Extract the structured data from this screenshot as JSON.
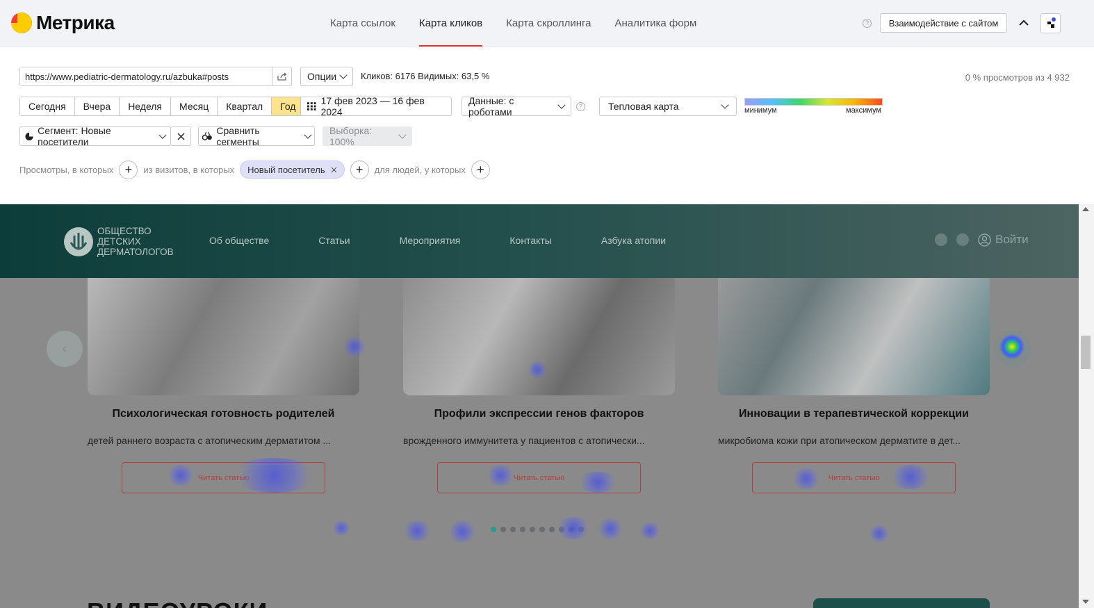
{
  "app": {
    "logo_text": "Метрика"
  },
  "tabs": [
    {
      "label": "Карта ссылок"
    },
    {
      "label": "Карта кликов",
      "active": true
    },
    {
      "label": "Карта скроллинга"
    },
    {
      "label": "Аналитика форм"
    }
  ],
  "header": {
    "help": "?",
    "interact_label": "Взаимодействие с сайтом"
  },
  "controls": {
    "url": "https://www.pediatric-dermatology.ru/azbuka#posts",
    "options_label": "Опции",
    "stats": "Кликов: 6176  Видимых: 63,5 %",
    "views": "0 % просмотров из 4 932",
    "periods": [
      "Сегодня",
      "Вчера",
      "Неделя",
      "Месяц",
      "Квартал",
      "Год"
    ],
    "active_period": "Год",
    "date_range": "17 фев 2023 — 16 фев 2024",
    "data_label": "Данные: с роботами",
    "map_type": "Тепловая карта",
    "legend_min": "минимум",
    "legend_max": "максимум",
    "segment_label": "Сегмент: Новые посетители",
    "compare_label": "Сравнить сегменты",
    "sample_label": "Выборка: 100%"
  },
  "filters": {
    "views_text": "Просмотры, в которых",
    "visits_text": "из визитов, в которых",
    "chip": "Новый посетитель",
    "people_text": "для людей, у которых"
  },
  "site": {
    "logo_text": "Общество детских дерматологов",
    "nav": [
      "Об обществе",
      "Статьи",
      "Мероприятия",
      "Контакты",
      "Азбука атопии"
    ],
    "login": "Войти",
    "cards": [
      {
        "title": "Психологическая готовность родителей",
        "desc": "детей раннего возраста с атопическим дерматитом ...",
        "button": "Читать статью"
      },
      {
        "title": "Профили экспрессии генов факторов",
        "desc": "врожденного иммунитета у пациентов с атопически...",
        "button": "Читать статью"
      },
      {
        "title": "Инновации в терапевтической коррекции",
        "desc": "микробиома кожи при атопическом дерматите в дет...",
        "button": "Читать статью"
      }
    ],
    "section_title": "ВИДЕОУРОКИ",
    "dots_count": 10,
    "active_dot": 0
  },
  "colors": {
    "accent": "#e0302b",
    "active_period": "#ffe38c",
    "site_teal": "#1c4e4a",
    "read_button": "#b1413e"
  }
}
